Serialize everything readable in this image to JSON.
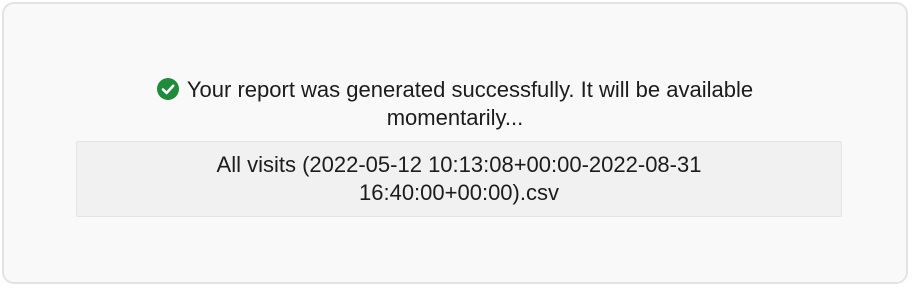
{
  "notice": {
    "icon": "check-circle-icon",
    "icon_color": "#1e8c3a",
    "message": "Your report was generated successfully. It will be available momentarily..."
  },
  "report": {
    "file_name": "All visits (2022-05-12 10:13:08+00:00-2022-08-31 16:40:00+00:00).csv"
  }
}
